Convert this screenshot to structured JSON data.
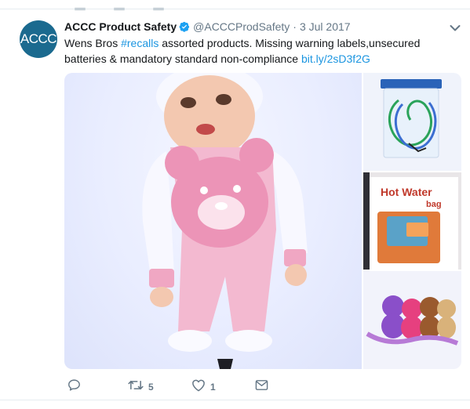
{
  "tweet": {
    "avatar_text": "ACCC",
    "avatar_color": "#1b6a8f",
    "name": "ACCC Product Safety",
    "verified_icon": "verified-badge-icon",
    "handle": "@ACCCProdSafety",
    "separator": "·",
    "date": "3 Jul 2017",
    "text_before": "Wens Bros ",
    "hashtag": "#recalls",
    "text_after": " assorted products. Missing warning labels,unsecured batteries & mandatory standard non-compliance ",
    "link": "bit.ly/2sD3f2G",
    "link_color": "#1b95e0",
    "media": {
      "thumb_2_label_line1": "Hot Water",
      "thumb_2_label_line2": "bag"
    },
    "actions": {
      "reply_icon": "reply-icon",
      "retweet_icon": "retweet-icon",
      "retweet_count": "5",
      "like_icon": "heart-icon",
      "like_count": "1",
      "message_icon": "envelope-icon"
    }
  }
}
